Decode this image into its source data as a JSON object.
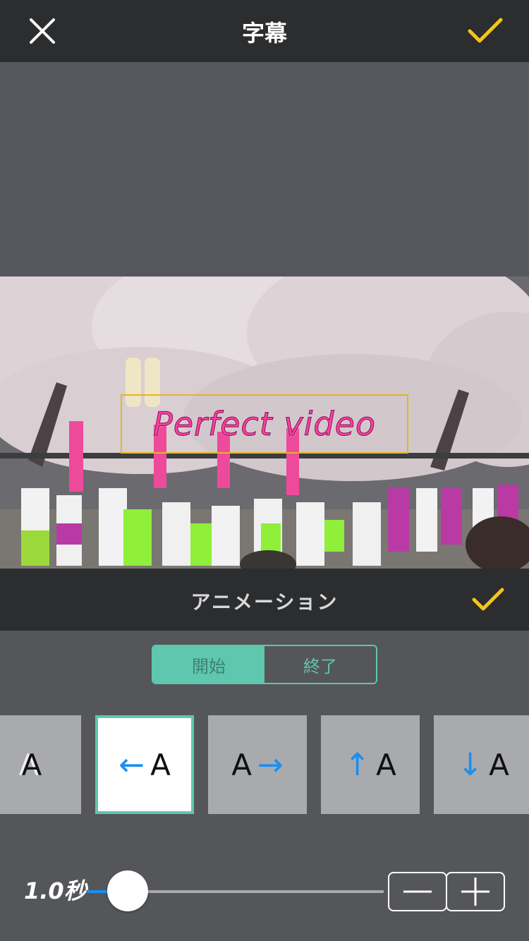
{
  "header": {
    "title": "字幕",
    "close_icon": "close-icon",
    "confirm_icon": "checkmark-icon",
    "confirm_color": "#f5c518"
  },
  "video": {
    "caption_text": "Perfect video",
    "caption_color": "#ff3fa0",
    "selection_color": "#e6b422"
  },
  "animation": {
    "title": "アニメーション",
    "confirm_icon": "checkmark-icon",
    "segments": [
      "開始",
      "終了"
    ],
    "active_segment": "開始",
    "accent": "#5ec7ad",
    "presets": [
      {
        "glyph": "A",
        "arrow": "",
        "icon": "shadow-text-icon",
        "selected": false
      },
      {
        "glyph": "A",
        "arrow": "←",
        "icon": "arrow-left-icon",
        "selected": true
      },
      {
        "glyph": "A",
        "arrow": "→",
        "icon": "arrow-right-icon",
        "selected": false
      },
      {
        "glyph": "A",
        "arrow": "↑",
        "icon": "arrow-up-icon",
        "selected": false
      },
      {
        "glyph": "A",
        "arrow": "↓",
        "icon": "arrow-down-icon",
        "selected": false
      }
    ]
  },
  "duration": {
    "label": "1.0秒",
    "slider_fraction": 0.07,
    "decrement_icon": "minus-icon",
    "increment_icon": "plus-icon"
  }
}
